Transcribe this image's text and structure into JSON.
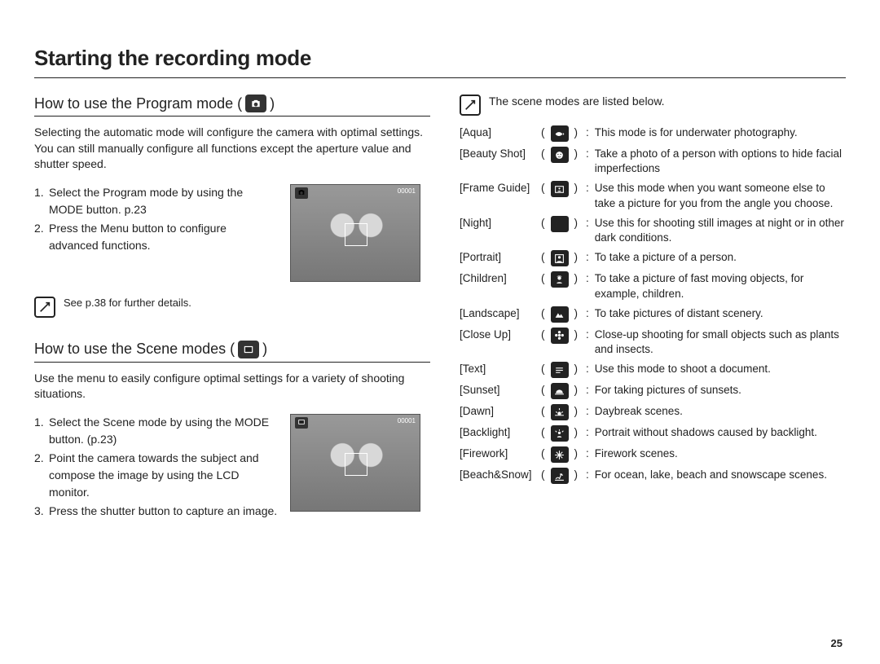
{
  "title": "Starting the recording mode",
  "page_number": "25",
  "program": {
    "heading_pre": "How to use the Program mode ( ",
    "heading_post": " )",
    "icon": "camera-program-icon",
    "intro": "Selecting the automatic mode will configure the camera with optimal settings. You can still manually configure all functions except the aperture value and shutter speed.",
    "steps": [
      "Select the Program mode by using the MODE button. p.23",
      "Press the Menu button to configure advanced functions."
    ],
    "lcd": {
      "counter": "00001",
      "battery": "▰▰▰"
    },
    "note": "See p.38 for further details."
  },
  "scene": {
    "heading_pre": "How to use the Scene modes ( ",
    "heading_post": " )",
    "icon": "scene-mode-icon",
    "intro": "Use the menu to easily configure optimal settings for a variety of shooting situations.",
    "steps": [
      "Select the Scene mode by using the MODE button. (p.23)",
      "Point the camera towards the subject and compose the image by using the LCD monitor.",
      "Press the shutter button to capture an image."
    ],
    "lcd": {
      "counter": "00001",
      "battery": "▰▰▰"
    }
  },
  "scenes_intro": "The scene modes are listed below.",
  "scenes": [
    {
      "label": "[Aqua]",
      "icon": "fish-icon",
      "desc": "This mode is for underwater photography."
    },
    {
      "label": "[Beauty Shot]",
      "icon": "face-icon",
      "desc": "Take a photo of a person with options to hide facial imperfections"
    },
    {
      "label": "[Frame Guide]",
      "icon": "frame-guide-icon",
      "desc": "Use this mode when you want someone else to take a picture for you from the angle you choose."
    },
    {
      "label": "[Night]",
      "icon": "moon-icon",
      "desc": "Use this for shooting still images at night or in other dark conditions."
    },
    {
      "label": "[Portrait]",
      "icon": "portrait-icon",
      "desc": "To take a picture of a person."
    },
    {
      "label": "[Children]",
      "icon": "children-icon",
      "desc": "To take a picture of fast moving objects, for example, children."
    },
    {
      "label": "[Landscape]",
      "icon": "mountain-icon",
      "desc": "To take pictures of distant scenery."
    },
    {
      "label": "[Close Up]",
      "icon": "flower-icon",
      "desc": "Close-up shooting for small objects such as plants and insects."
    },
    {
      "label": "[Text]",
      "icon": "text-icon",
      "desc": "Use this mode to shoot a document."
    },
    {
      "label": "[Sunset]",
      "icon": "sunset-icon",
      "desc": "For taking pictures of sunsets."
    },
    {
      "label": "[Dawn]",
      "icon": "dawn-icon",
      "desc": "Daybreak scenes."
    },
    {
      "label": "[Backlight]",
      "icon": "backlight-icon",
      "desc": "Portrait without shadows caused by backlight."
    },
    {
      "label": "[Firework]",
      "icon": "firework-icon",
      "desc": "Firework scenes."
    },
    {
      "label": "[Beach&Snow]",
      "icon": "beach-icon",
      "desc": "For ocean, lake, beach and snowscape scenes."
    }
  ]
}
